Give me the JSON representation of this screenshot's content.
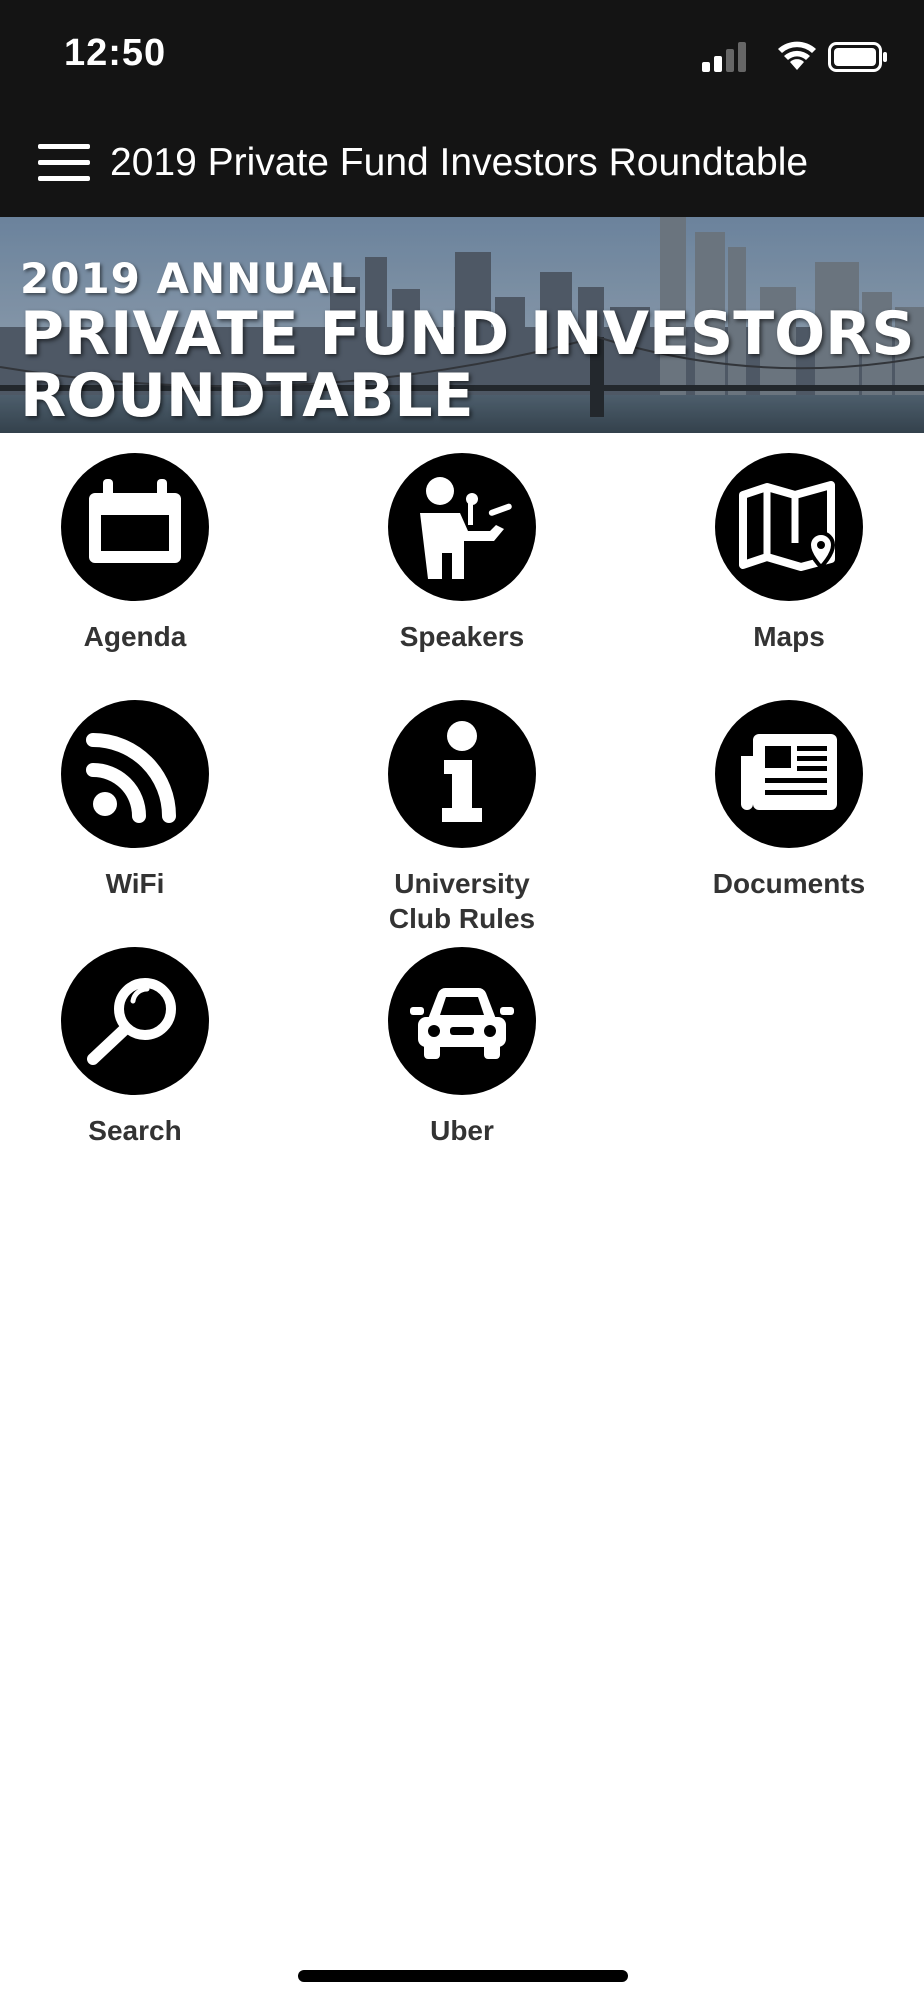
{
  "status_bar": {
    "time": "12:50"
  },
  "header": {
    "title": "2019 Private Fund Investors Roundtable"
  },
  "banner": {
    "line1": "2019 ANNUAL",
    "line2": "PRIVATE FUND INVESTORS",
    "line3": "ROUNDTABLE"
  },
  "tiles": [
    {
      "label": "Agenda",
      "icon": "calendar-icon"
    },
    {
      "label": "Speakers",
      "icon": "speaker-icon"
    },
    {
      "label": "Maps",
      "icon": "map-icon"
    },
    {
      "label": "WiFi",
      "icon": "wifi-signal-icon"
    },
    {
      "label": "University\nClub Rules",
      "icon": "info-icon"
    },
    {
      "label": "Documents",
      "icon": "newspaper-icon"
    },
    {
      "label": "Search",
      "icon": "search-icon"
    },
    {
      "label": "Uber",
      "icon": "car-icon"
    }
  ],
  "colors": {
    "header_bg": "#141414",
    "icon_bg": "#000000",
    "label_text": "#333333"
  }
}
